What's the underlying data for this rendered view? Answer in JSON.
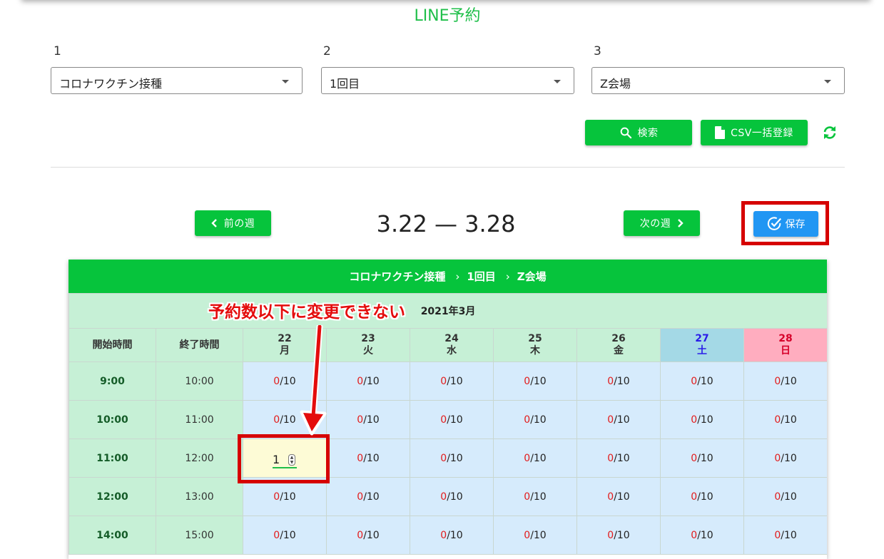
{
  "header": {
    "title": "LINE予約"
  },
  "filters": [
    {
      "label": "1",
      "value": "コロナワクチン接種"
    },
    {
      "label": "2",
      "value": "1回目"
    },
    {
      "label": "3",
      "value": "Z会場"
    }
  ],
  "actions": {
    "search_label": "検索",
    "csv_label": "CSV一括登録"
  },
  "week_nav": {
    "prev_label": "前の週",
    "next_label": "次の週",
    "range": "3.22 — 3.28",
    "save_label": "保存"
  },
  "calendar": {
    "breadcrumb": [
      "コロナワクチン接種",
      "1回目",
      "Z会場"
    ],
    "month": "2021年3月",
    "col_start": "開始時間",
    "col_end": "終了時間",
    "days": [
      {
        "date": "22",
        "dow": "月"
      },
      {
        "date": "23",
        "dow": "火"
      },
      {
        "date": "24",
        "dow": "水"
      },
      {
        "date": "25",
        "dow": "木"
      },
      {
        "date": "26",
        "dow": "金"
      },
      {
        "date": "27",
        "dow": "土"
      },
      {
        "date": "28",
        "dow": "日"
      }
    ],
    "rows": [
      {
        "start": "9:00",
        "end": "10:00",
        "slots": [
          [
            "0",
            "/10"
          ],
          [
            "0",
            "/10"
          ],
          [
            "0",
            "/10"
          ],
          [
            "0",
            "/10"
          ],
          [
            "0",
            "/10"
          ],
          [
            "0",
            "/10"
          ],
          [
            "0",
            "/10"
          ]
        ]
      },
      {
        "start": "10:00",
        "end": "11:00",
        "slots": [
          [
            "0",
            "/10"
          ],
          [
            "0",
            "/10"
          ],
          [
            "0",
            "/10"
          ],
          [
            "0",
            "/10"
          ],
          [
            "0",
            "/10"
          ],
          [
            "0",
            "/10"
          ],
          [
            "0",
            "/10"
          ]
        ]
      },
      {
        "start": "11:00",
        "end": "12:00",
        "edit_value": "1",
        "slots": [
          [
            "",
            ""
          ],
          [
            "0",
            "/10"
          ],
          [
            "0",
            "/10"
          ],
          [
            "0",
            "/10"
          ],
          [
            "0",
            "/10"
          ],
          [
            "0",
            "/10"
          ],
          [
            "0",
            "/10"
          ]
        ]
      },
      {
        "start": "12:00",
        "end": "13:00",
        "slots": [
          [
            "0",
            "/10"
          ],
          [
            "0",
            "/10"
          ],
          [
            "0",
            "/10"
          ],
          [
            "0",
            "/10"
          ],
          [
            "0",
            "/10"
          ],
          [
            "0",
            "/10"
          ],
          [
            "0",
            "/10"
          ]
        ]
      },
      {
        "start": "14:00",
        "end": "15:00",
        "slots": [
          [
            "0",
            "/10"
          ],
          [
            "0",
            "/10"
          ],
          [
            "0",
            "/10"
          ],
          [
            "0",
            "/10"
          ],
          [
            "0",
            "/10"
          ],
          [
            "0",
            "/10"
          ],
          [
            "0",
            "/10"
          ]
        ]
      }
    ]
  },
  "annotation": {
    "text": "予約数以下に変更できない"
  },
  "colors": {
    "brand_green": "#06c43c",
    "save_blue": "#2196f3",
    "highlight_red": "#d60000"
  }
}
